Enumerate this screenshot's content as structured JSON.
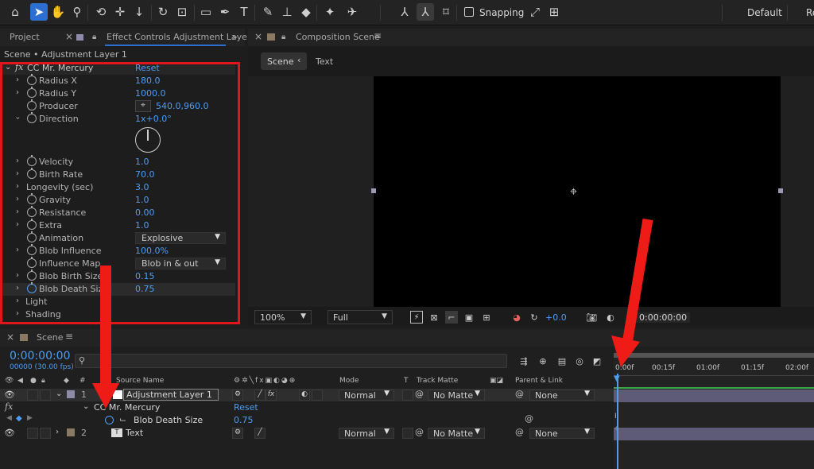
{
  "toolbar": {
    "snapping_label": "Snapping",
    "workspace_default": "Default",
    "workspace_next": "Re",
    "tool_icons": [
      "home-icon",
      "selection-tool-icon",
      "hand-tool-icon",
      "zoom-tool-icon",
      "orbit-camera-icon",
      "pan-camera-icon",
      "dolly-camera-icon",
      "rotate-tool-icon",
      "pan-behind-icon",
      "rectangle-tool-icon",
      "pen-tool-icon",
      "type-tool-icon",
      "brush-tool-icon",
      "clone-stamp-icon",
      "eraser-icon",
      "roto-brush-icon",
      "puppet-pin-icon"
    ]
  },
  "left_panel": {
    "tab_project": "Project",
    "tab_effect_controls": "Effect Controls Adjustment Layer",
    "breadcrumb": "Scene • Adjustment Layer 1",
    "effect_name": "CC Mr. Mercury",
    "reset_label": "Reset",
    "properties": [
      {
        "name": "Radius X",
        "value": "180.0"
      },
      {
        "name": "Radius Y",
        "value": "1000.0"
      },
      {
        "name": "Producer",
        "value": "540.0,960.0"
      },
      {
        "name": "Direction",
        "value": "1x+0.0°"
      },
      {
        "name": "Velocity",
        "value": "1.0"
      },
      {
        "name": "Birth Rate",
        "value": "70.0"
      },
      {
        "name": "Longevity (sec)",
        "value": "3.0"
      },
      {
        "name": "Gravity",
        "value": "1.0"
      },
      {
        "name": "Resistance",
        "value": "0.00"
      },
      {
        "name": "Extra",
        "value": "1.0"
      },
      {
        "name": "Animation",
        "value": "Explosive"
      },
      {
        "name": "Blob Influence",
        "value": "100.0%"
      },
      {
        "name": "Influence Map",
        "value": "Blob in & out"
      },
      {
        "name": "Blob Birth Size",
        "value": "0.15"
      },
      {
        "name": "Blob Death Size",
        "value": "0.75"
      },
      {
        "name": "Light",
        "value": ""
      },
      {
        "name": "Shading",
        "value": ""
      }
    ]
  },
  "comp_panel": {
    "title": "Composition Scene",
    "breadcrumb_scene": "Scene",
    "breadcrumb_text": "Text",
    "zoom": "100%",
    "resolution": "Full",
    "exposure": "+0.0",
    "timecode": "0:00:00:00"
  },
  "timeline": {
    "tab": "Scene",
    "timecode": "0:00:00:00",
    "frame_info": "00000 (30.00 fps)",
    "search_placeholder": "",
    "columns": {
      "hash": "#",
      "source_name": "Source Name",
      "mode": "Mode",
      "t": "T",
      "track_matte": "Track Matte",
      "parent": "Parent & Link"
    },
    "ruler": [
      "0:00f",
      "00:15f",
      "01:00f",
      "01:15f",
      "02:00f"
    ],
    "layers": [
      {
        "num": "1",
        "name": "Adjustment Layer 1",
        "mode": "Normal",
        "matte": "No Matte",
        "parent": "None"
      },
      {
        "num": "2",
        "name": "Text",
        "mode": "Normal",
        "matte": "No Matte",
        "parent": "None"
      }
    ],
    "effect_row": {
      "name": "CC Mr. Mercury",
      "reset": "Reset"
    },
    "prop_row": {
      "name": "Blob Death Size",
      "value": "0.75"
    }
  },
  "colors": {
    "accent_blue": "#4d9df4",
    "highlight_red": "#e0161a",
    "arrow_red": "#ef1b16",
    "selected_tool": "#2d6fd0"
  }
}
